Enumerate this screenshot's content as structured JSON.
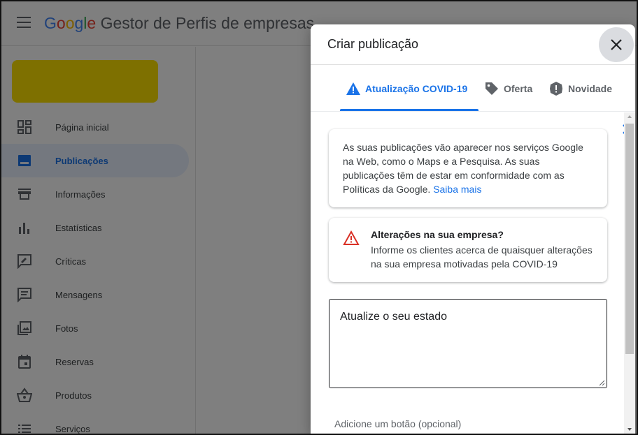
{
  "app": {
    "title_google_letters": [
      "G",
      "o",
      "o",
      "g",
      "l",
      "e"
    ],
    "title_rest": " Gestor de Perfis de empresas"
  },
  "sidebar": {
    "items": [
      {
        "label": "Página inicial",
        "icon": "dashboard-icon"
      },
      {
        "label": "Publicações",
        "icon": "posts-icon",
        "active": true
      },
      {
        "label": "Informações",
        "icon": "storefront-icon"
      },
      {
        "label": "Estatísticas",
        "icon": "bar-chart-icon"
      },
      {
        "label": "Críticas",
        "icon": "reviews-icon"
      },
      {
        "label": "Mensagens",
        "icon": "messages-icon"
      },
      {
        "label": "Fotos",
        "icon": "photos-icon"
      },
      {
        "label": "Reservas",
        "icon": "calendar-icon"
      },
      {
        "label": "Produtos",
        "icon": "basket-icon"
      },
      {
        "label": "Serviços",
        "icon": "list-icon"
      }
    ]
  },
  "dialog": {
    "title": "Criar publicação",
    "tabs": [
      {
        "label": "Atualização COVID-19",
        "icon": "warning-icon",
        "active": true
      },
      {
        "label": "Oferta",
        "icon": "tag-icon"
      },
      {
        "label": "Novidade",
        "icon": "alert-badge-icon"
      }
    ],
    "info_card": {
      "text": "As suas publicações vão aparecer nos serviços Google na Web, como o Maps e a Pesquisa. As suas publicações têm de estar em conformidade com as Políticas da Google.",
      "link": "Saiba mais"
    },
    "alert_card": {
      "title": "Alterações na sua empresa?",
      "description": "Informe os clientes acerca de quaisquer alterações na sua empresa motivadas pela COVID-19"
    },
    "status_input": {
      "placeholder": "Atualize o seu estado"
    },
    "add_button_label": "Adicione um botão (opcional)"
  },
  "colors": {
    "accent": "#1a73e8",
    "business_card": "#fde100",
    "warning_red": "#d93025"
  }
}
